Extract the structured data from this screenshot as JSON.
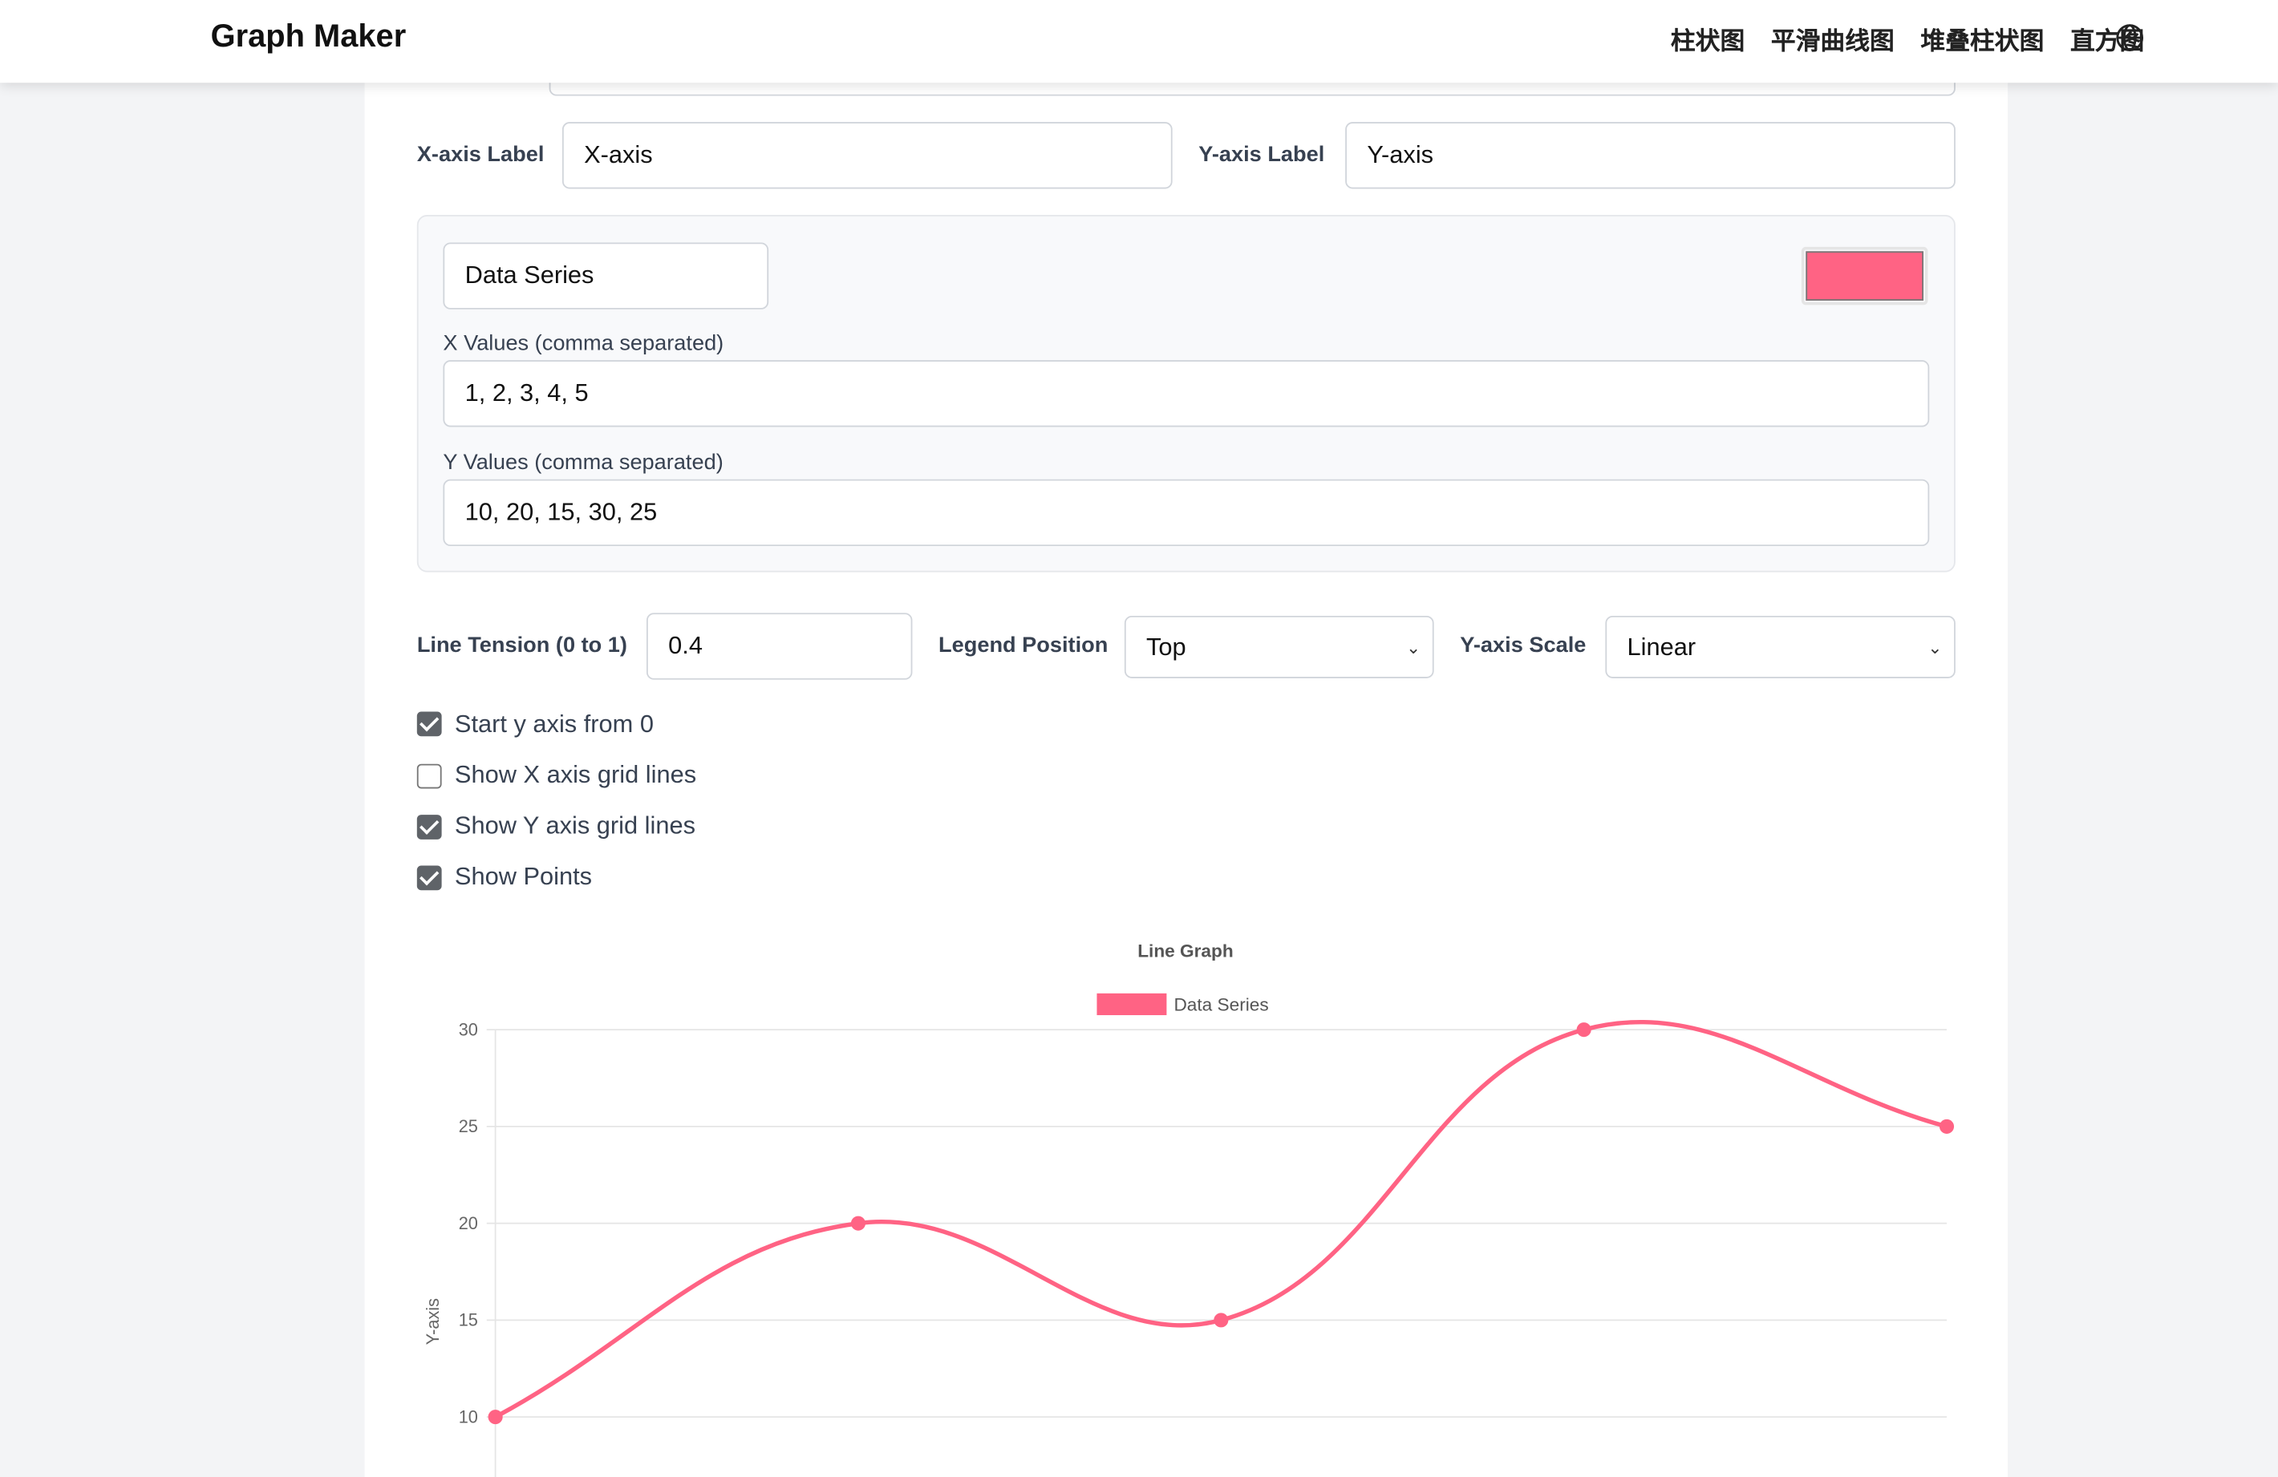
{
  "header": {
    "brand": "Graph Maker",
    "nav": [
      "柱状图",
      "平滑曲线图",
      "堆叠柱状图",
      "直方图"
    ],
    "language_icon": "globe-icon"
  },
  "form": {
    "x_axis_label": {
      "label": "X-axis Label",
      "value": "X-axis"
    },
    "y_axis_label": {
      "label": "Y-axis Label",
      "value": "Y-axis"
    },
    "series": {
      "name": "Data Series",
      "color": "#ff6384",
      "x_label": "X Values (comma separated)",
      "x_value": "1, 2, 3, 4, 5",
      "y_label": "Y Values (comma separated)",
      "y_value": "10, 20, 15, 30, 25"
    },
    "line_tension": {
      "label": "Line Tension (0 to 1)",
      "value": "0.4"
    },
    "legend_position": {
      "label": "Legend Position",
      "value": "Top"
    },
    "y_scale": {
      "label": "Y-axis Scale",
      "value": "Linear"
    },
    "checkboxes": [
      {
        "label": "Start y axis from 0",
        "checked": true
      },
      {
        "label": "Show X axis grid lines",
        "checked": false
      },
      {
        "label": "Show Y axis grid lines",
        "checked": true
      },
      {
        "label": "Show Points",
        "checked": true
      }
    ]
  },
  "chart_data": {
    "type": "line",
    "title": "Line Graph",
    "ylabel": "Y-axis",
    "xlabel": "X-axis",
    "legend_position": "top",
    "grid_y": true,
    "grid_x": false,
    "tension": 0.4,
    "x": [
      1,
      2,
      3,
      4,
      5
    ],
    "series": [
      {
        "name": "Data Series",
        "values": [
          10,
          20,
          15,
          30,
          25
        ],
        "color": "#ff6384"
      }
    ],
    "ylim": [
      0,
      30
    ],
    "yticks": [
      "10",
      "15",
      "20",
      "25",
      "30"
    ]
  }
}
